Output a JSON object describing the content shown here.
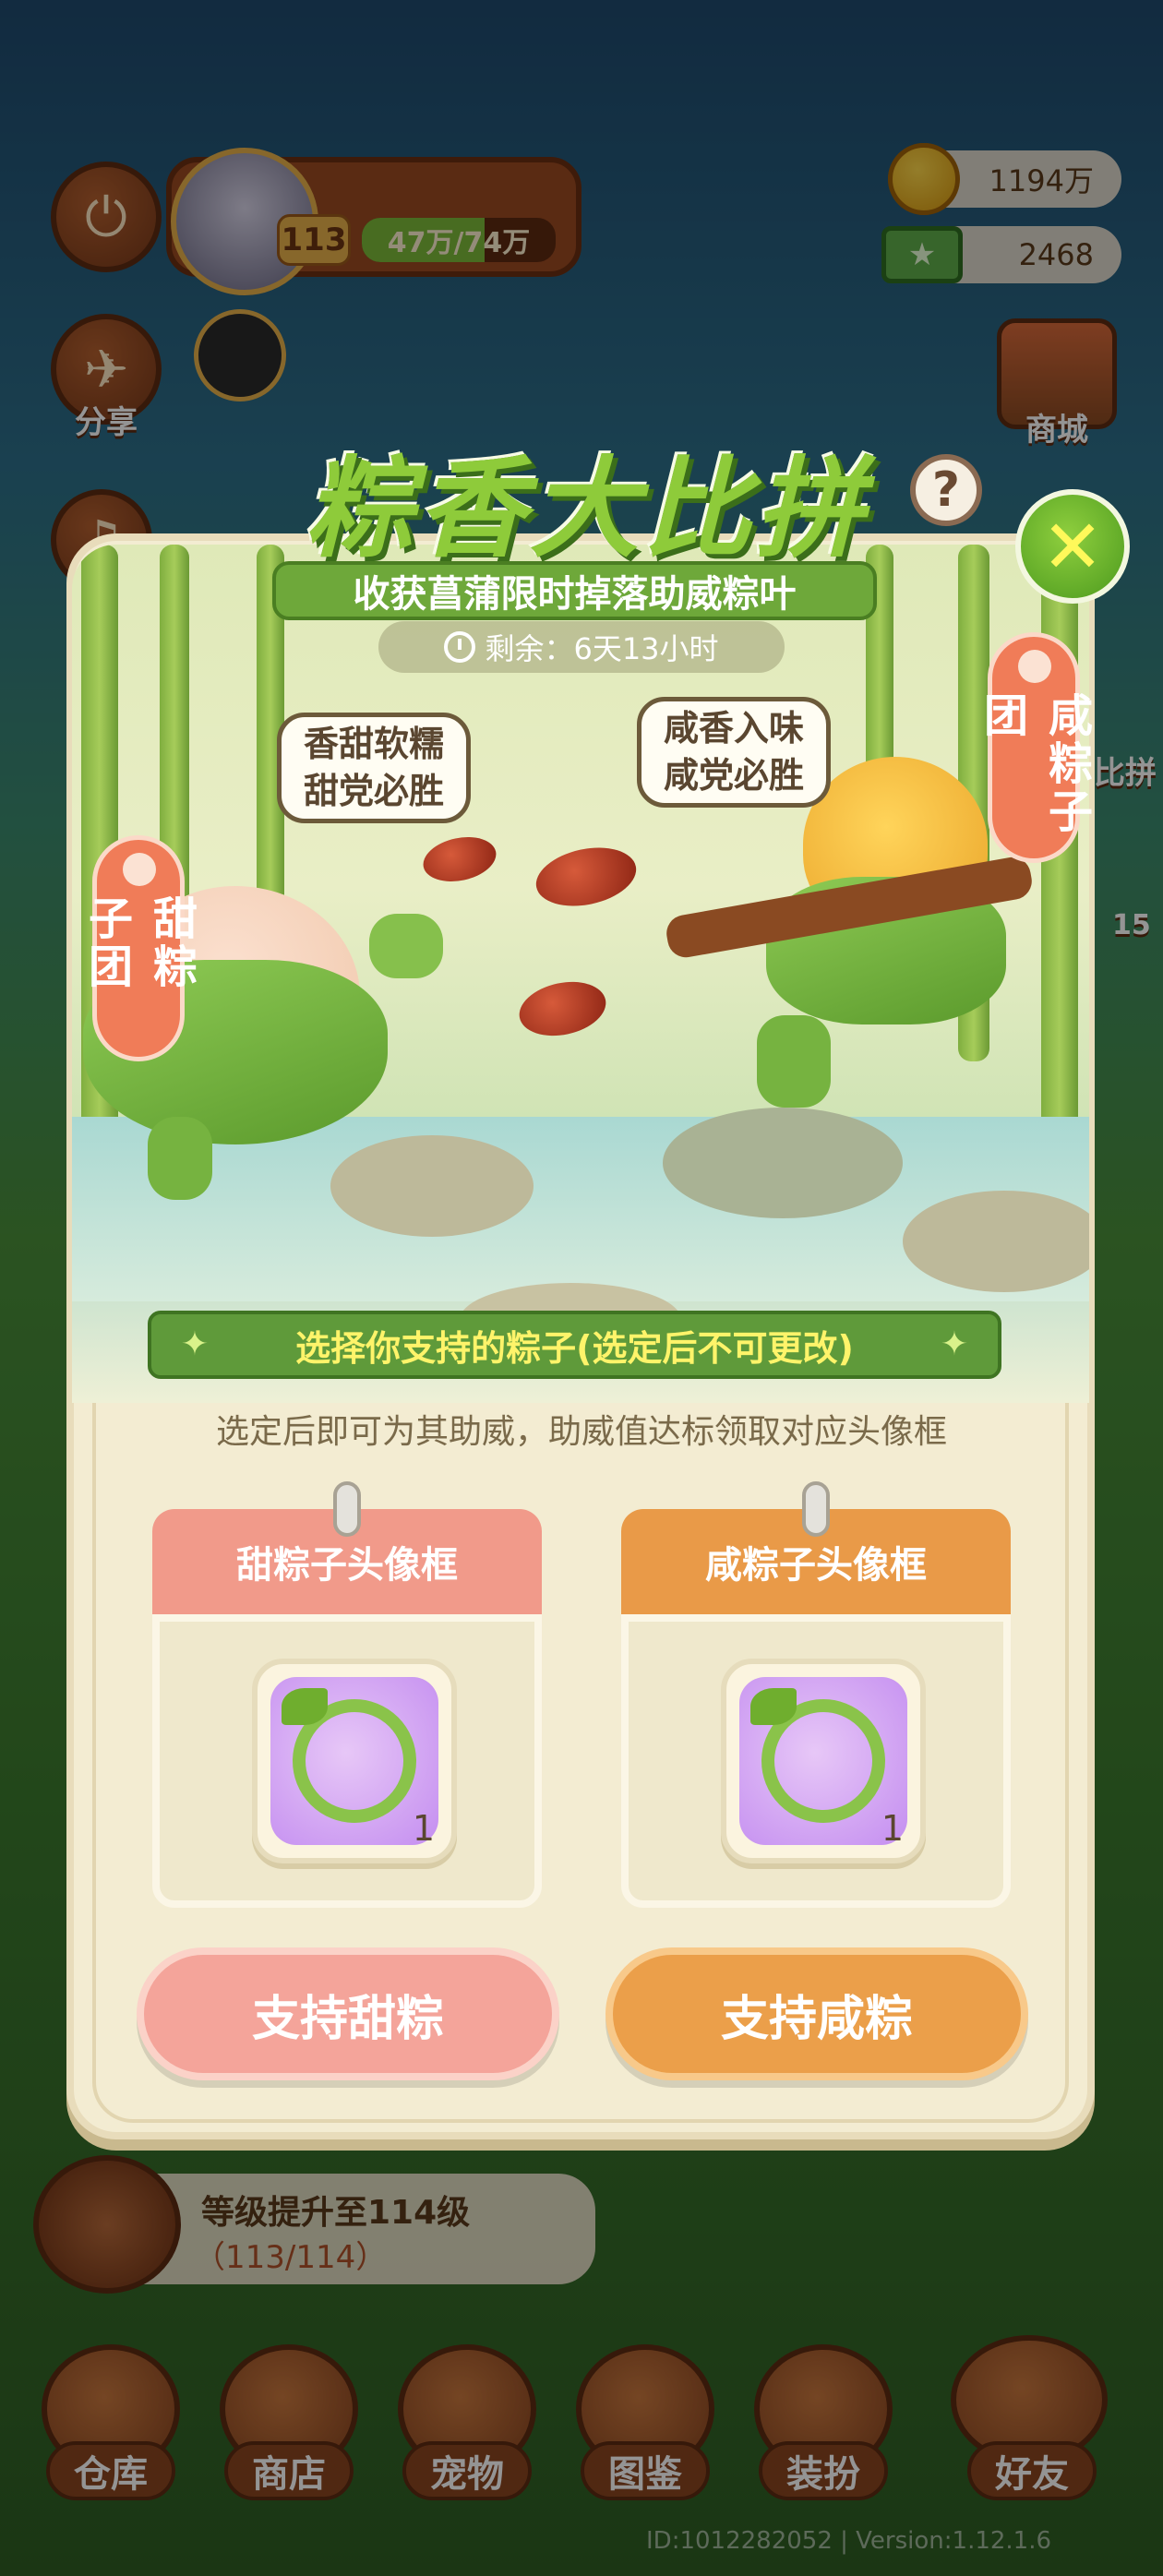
{
  "hud": {
    "share_label": "分享",
    "player": {
      "level": "113",
      "exp_text": "47万/74万",
      "exp_fraction": 0.635
    },
    "coins": "1194万",
    "cash": "2468",
    "shop_label": "商城",
    "side_peek_text": "比拼",
    "side_peek_num": "15"
  },
  "popup": {
    "title": "粽香大比拼",
    "help_symbol": "?",
    "close_symbol": "✕",
    "subtitle": "收获菖蒲限时掉落助威粽叶",
    "timer": "剩余：6天13小时",
    "sweet_tag": "甜粽子团",
    "savory_tag": "咸粽子团",
    "sweet_bubble": [
      "香甜软糯",
      "甜党必胜"
    ],
    "savory_bubble": [
      "咸香入味",
      "咸党必胜"
    ],
    "select_title": "选择你支持的粽子(选定后不可更改)",
    "select_hint": "选定后即可为其助威，助威值达标领取对应头像框",
    "cards": [
      {
        "title": "甜粽子头像框",
        "qty": "1",
        "button": "支持甜粽",
        "head_color": "#f19a8a",
        "button_color": "#f4a49a"
      },
      {
        "title": "咸粽子头像框",
        "qty": "1",
        "button": "支持咸粽",
        "head_color": "#e99a48",
        "button_color": "#eb9f4a"
      }
    ]
  },
  "quest": {
    "title": "等级提升至114级",
    "progress": "（113/114）"
  },
  "nav": [
    "仓库",
    "商店",
    "宠物",
    "图鉴",
    "装扮",
    "好友"
  ],
  "footer": "ID:1012282052  |  Version:1.12.1.6"
}
